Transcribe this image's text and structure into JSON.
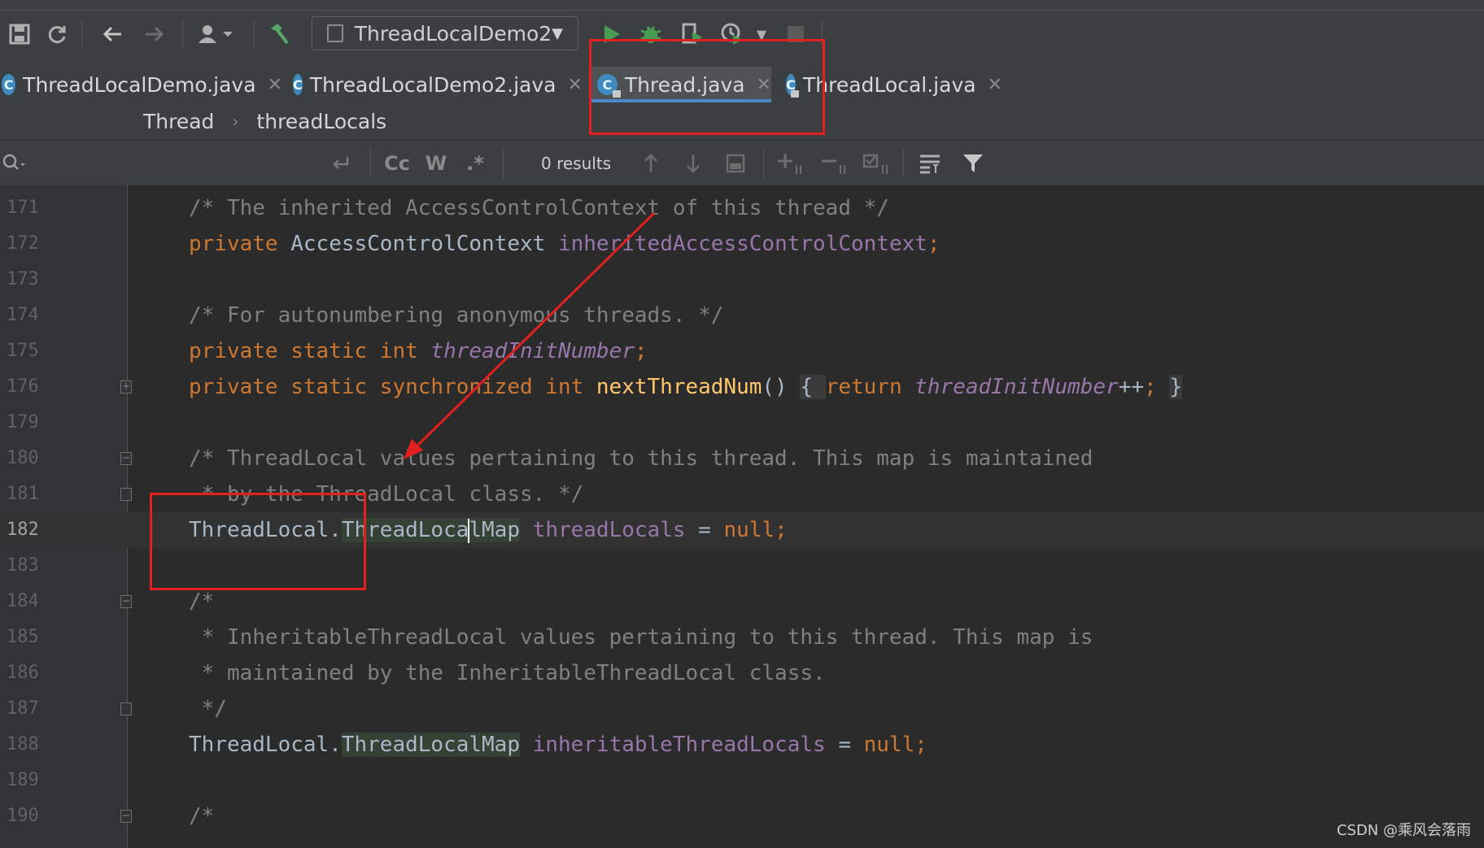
{
  "run_config": {
    "label": "ThreadLocalDemo2"
  },
  "tabs": [
    {
      "label": "ThreadLocalDemo.java",
      "active": false
    },
    {
      "label": "ThreadLocalDemo2.java",
      "active": false
    },
    {
      "label": "Thread.java",
      "active": true
    },
    {
      "label": "ThreadLocal.java",
      "active": false
    }
  ],
  "breadcrumb": {
    "class": "Thread",
    "field": "threadLocals"
  },
  "find": {
    "results": "0 results",
    "case_label": "Cc",
    "word_label": "W",
    "regex_label": ".*"
  },
  "lines": [
    {
      "n": "171"
    },
    {
      "n": "172"
    },
    {
      "n": "173"
    },
    {
      "n": "174"
    },
    {
      "n": "175"
    },
    {
      "n": "176"
    },
    {
      "n": "179"
    },
    {
      "n": "180"
    },
    {
      "n": "181"
    },
    {
      "n": "182"
    },
    {
      "n": "183"
    },
    {
      "n": "184"
    },
    {
      "n": "185"
    },
    {
      "n": "186"
    },
    {
      "n": "187"
    },
    {
      "n": "188"
    },
    {
      "n": "189"
    },
    {
      "n": "190"
    }
  ],
  "code": {
    "l171": "/* The inherited AccessControlContext of this thread */",
    "l172_kw": "private ",
    "l172_type": "AccessControlContext ",
    "l172_field": "inheritedAccessControlContext",
    "l172_end": ";",
    "l174": "/* For autonumbering anonymous threads. */",
    "l175_kw": "private static int ",
    "l175_field": "threadInitNumber",
    "l175_end": ";",
    "l176_kw": "private static synchronized int ",
    "l176_fn": "nextThreadNum",
    "l176_paren": "() ",
    "l176_open": "{ ",
    "l176_ret": "return ",
    "l176_field": "threadInitNumber",
    "l176_op": "++",
    "l176_semi": "; ",
    "l176_close": "}",
    "l180": "/* ThreadLocal values pertaining to this thread. This map is maintained",
    "l181": " * by the ThreadLocal class. */",
    "l182_type": "ThreadLocal.",
    "l182_map_a": "ThreadLoca",
    "l182_map_b": "lMap",
    "l182_field": " threadLocals",
    "l182_eq": " = ",
    "l182_null": "null;",
    "l184": "/*",
    "l185": " * InheritableThreadLocal values pertaining to this thread. This map is",
    "l186": " * maintained by the InheritableThreadLocal class.",
    "l187": " */",
    "l188_type": "ThreadLocal.",
    "l188_map": "ThreadLocalMap",
    "l188_field": " inheritableThreadLocals",
    "l188_eq": " = ",
    "l188_null": "null;",
    "l190": "/*"
  },
  "watermark": "CSDN @乘风会落雨",
  "colors": {
    "keyword": "#cc7832",
    "comment": "#808080",
    "field": "#9876aa",
    "method": "#ffc66d",
    "annotation": "#e22020",
    "tab_underline": "#4a88c7"
  }
}
